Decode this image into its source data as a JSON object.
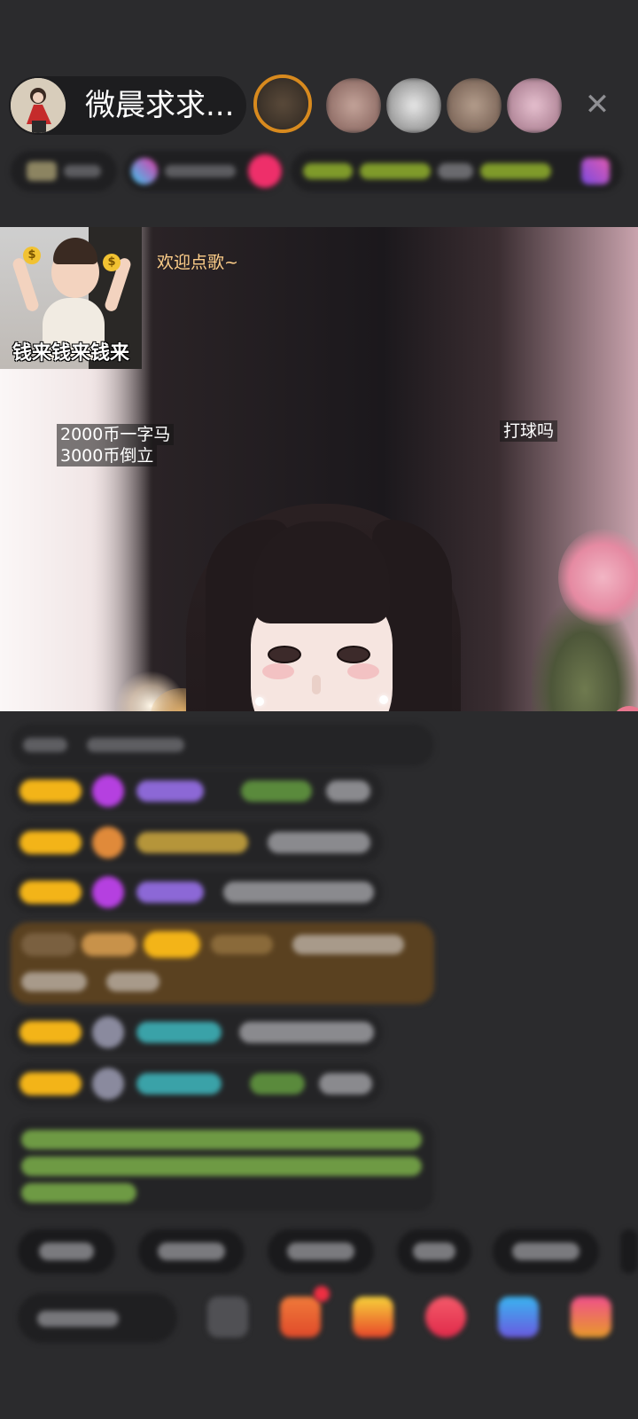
{
  "header": {
    "host_name": "微晨求求...",
    "close_icon": "close-icon"
  },
  "video": {
    "pip_caption": "钱来钱来钱来",
    "welcome_text": "欢迎点歌~",
    "price_line_1": "2000币一字马",
    "price_line_2": "3000币倒立",
    "ball_text": "打球吗"
  },
  "colors": {
    "background": "#2b2b2d",
    "level_badge": "#f3b418",
    "gift_highlight": "#5a4120",
    "notice_text": "#7fb04a",
    "accent_pink": "#ee2f6a"
  }
}
